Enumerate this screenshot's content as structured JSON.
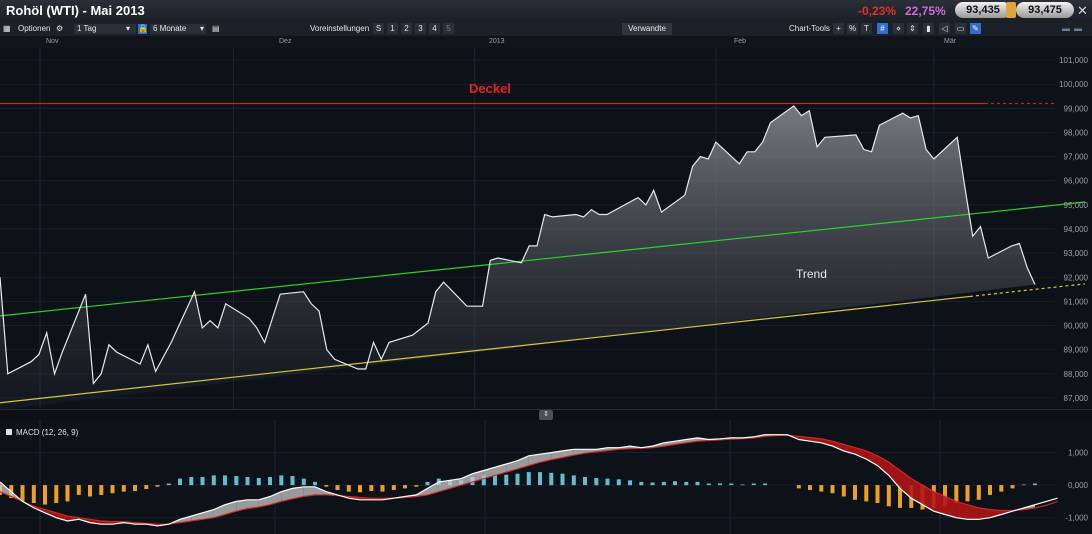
{
  "header": {
    "title": "Rohöl (WTI) - Mai 2013",
    "change_abs": "-0,23%",
    "change_pct": "22,75%",
    "bid": "93,435",
    "ask": "93,475"
  },
  "toolbar": {
    "optionen": "Optionen",
    "interval": "1 Tag",
    "range": "6 Monate",
    "voreinstellungen": "Voreinstellungen",
    "presets": [
      "S",
      "1",
      "2",
      "3",
      "4",
      "5"
    ],
    "verwandte": "Verwandte",
    "chart_tools": "Chart-Tools"
  },
  "colors": {
    "price_line": "#e8e8e8",
    "resistance": "#d02020",
    "upper_trend": "#2fd02f",
    "lower_trend": "#d8c83a",
    "macd_pos_bar": "#5fbfd0",
    "macd_neg_bar": "#f0a020",
    "signal": "#d02828"
  },
  "chart_data": [
    {
      "type": "area",
      "x": [
        "2012-11-01",
        "2012-11-02",
        "2012-11-05",
        "2012-11-06",
        "2012-11-07",
        "2012-11-08",
        "2012-11-09",
        "2012-11-12",
        "2012-11-13",
        "2012-11-14",
        "2012-11-15",
        "2012-11-16",
        "2012-11-19",
        "2012-11-20",
        "2012-11-21",
        "2012-11-23",
        "2012-11-26",
        "2012-11-27",
        "2012-11-28",
        "2012-11-29",
        "2012-11-30",
        "2012-12-03",
        "2012-12-04",
        "2012-12-05",
        "2012-12-06",
        "2012-12-07",
        "2012-12-10",
        "2012-12-11",
        "2012-12-12",
        "2012-12-13",
        "2012-12-14",
        "2012-12-17",
        "2012-12-18",
        "2012-12-19",
        "2012-12-20",
        "2012-12-21",
        "2012-12-24",
        "2012-12-26",
        "2012-12-27",
        "2012-12-28",
        "2012-12-31",
        "2013-01-02",
        "2013-01-03",
        "2013-01-04",
        "2013-01-07",
        "2013-01-08",
        "2013-01-09",
        "2013-01-10",
        "2013-01-11",
        "2013-01-14",
        "2013-01-15",
        "2013-01-16",
        "2013-01-17",
        "2013-01-18",
        "2013-01-22",
        "2013-01-23",
        "2013-01-24",
        "2013-01-25",
        "2013-01-28",
        "2013-01-29",
        "2013-01-30",
        "2013-01-31",
        "2013-02-01",
        "2013-02-04",
        "2013-02-05",
        "2013-02-06",
        "2013-02-07",
        "2013-02-08",
        "2013-02-11",
        "2013-02-12",
        "2013-02-13",
        "2013-02-14",
        "2013-02-15",
        "2013-02-19",
        "2013-02-20",
        "2013-02-21",
        "2013-02-22",
        "2013-02-25",
        "2013-02-26",
        "2013-02-27",
        "2013-02-28",
        "2013-03-01",
        "2013-03-04",
        "2013-03-05",
        "2013-03-06",
        "2013-03-07",
        "2013-03-08",
        "2013-03-11",
        "2013-03-12",
        "2013-03-13",
        "2013-03-14"
      ],
      "y": [
        92.0,
        88.0,
        88.5,
        88.8,
        89.7,
        88.0,
        88.9,
        91.3,
        87.6,
        88.0,
        89.2,
        88.9,
        88.4,
        89.2,
        88.1,
        89.3,
        91.4,
        89.9,
        90.2,
        89.9,
        90.9,
        90.3,
        89.9,
        89.3,
        90.3,
        91.3,
        91.4,
        90.9,
        90.6,
        89.0,
        88.6,
        88.2,
        88.2,
        89.3,
        88.6,
        89.3,
        89.6,
        90.1,
        91.4,
        91.8,
        90.8,
        90.8,
        92.7,
        92.8,
        92.6,
        93.3,
        93.3,
        94.6,
        94.5,
        94.6,
        94.5,
        94.8,
        94.6,
        94.6,
        95.3,
        95.0,
        95.6,
        94.7,
        95.4,
        96.6,
        97.0,
        96.9,
        97.6,
        96.7,
        97.2,
        97.2,
        97.6,
        98.4,
        99.1,
        98.7,
        98.9,
        97.4,
        97.8,
        97.9,
        97.3,
        97.2,
        98.3,
        98.8,
        98.6,
        98.7,
        97.3,
        96.9,
        97.8,
        95.7,
        93.7,
        94.1,
        92.8,
        93.3,
        93.4,
        92.4,
        91.7,
        91.0,
        91.4,
        91.1,
        92.2,
        92.5,
        92.7,
        93.2,
        93.1,
        93.8
      ],
      "ylim": [
        86.5,
        101.5
      ],
      "y_ticks": [
        "87,000",
        "88,000",
        "89,000",
        "90,000",
        "91,000",
        "92,000",
        "93,000",
        "94,000",
        "95,000",
        "96,000",
        "97,000",
        "98,000",
        "99,000",
        "100,000",
        "101,000"
      ],
      "x_ticks": [
        "Nov",
        "Dez",
        "2013",
        "Feb",
        "Mär"
      ],
      "annotations": [
        {
          "text": "Deckel",
          "type": "horizontal",
          "y": 99.2
        },
        {
          "text": "Trend",
          "type": "trendline",
          "from": [
            "2012-11-01",
            86.8
          ],
          "to": [
            "2013-03-14",
            91.5
          ]
        },
        {
          "type": "trendline",
          "from": [
            "2012-11-01",
            90.4
          ],
          "to": [
            "2013-03-14",
            94.9
          ]
        }
      ],
      "grid": true
    },
    {
      "type": "bar",
      "title": "MACD (12, 26, 9)",
      "values": [
        -0.3,
        -0.4,
        -0.5,
        -0.55,
        -0.6,
        -0.55,
        -0.5,
        -0.3,
        -0.35,
        -0.3,
        -0.25,
        -0.2,
        -0.18,
        -0.12,
        -0.05,
        0.05,
        0.2,
        0.25,
        0.25,
        0.3,
        0.3,
        0.28,
        0.25,
        0.22,
        0.25,
        0.3,
        0.28,
        0.2,
        0.1,
        -0.05,
        -0.15,
        -0.2,
        -0.22,
        -0.18,
        -0.2,
        -0.15,
        -0.1,
        -0.05,
        0.1,
        0.2,
        0.15,
        0.15,
        0.25,
        0.3,
        0.3,
        0.32,
        0.35,
        0.4,
        0.4,
        0.38,
        0.35,
        0.3,
        0.25,
        0.22,
        0.2,
        0.18,
        0.15,
        0.1,
        0.08,
        0.1,
        0.12,
        0.1,
        0.1,
        0.05,
        0.05,
        0.05,
        0.02,
        0.05,
        0.05,
        0.0,
        0.0,
        -0.1,
        -0.15,
        -0.2,
        -0.25,
        -0.35,
        -0.45,
        -0.5,
        -0.55,
        -0.65,
        -0.7,
        -0.7,
        -0.75,
        -0.7,
        -0.65,
        -0.55,
        -0.5,
        -0.45,
        -0.3,
        -0.2,
        -0.1,
        0.02,
        0.05
      ],
      "macd_line": [
        0.1,
        -0.2,
        -0.5,
        -0.7,
        -0.85,
        -1.0,
        -1.1,
        -1.05,
        -1.15,
        -1.2,
        -1.2,
        -1.15,
        -1.2,
        -1.2,
        -1.25,
        -1.2,
        -1.05,
        -0.95,
        -0.85,
        -0.75,
        -0.6,
        -0.5,
        -0.45,
        -0.45,
        -0.35,
        -0.2,
        -0.1,
        -0.05,
        -0.05,
        -0.2,
        -0.3,
        -0.4,
        -0.45,
        -0.45,
        -0.45,
        -0.4,
        -0.35,
        -0.3,
        -0.1,
        0.1,
        0.15,
        0.2,
        0.35,
        0.45,
        0.55,
        0.65,
        0.75,
        0.9,
        0.95,
        1.0,
        1.05,
        1.1,
        1.1,
        1.1,
        1.15,
        1.15,
        1.2,
        1.15,
        1.2,
        1.3,
        1.35,
        1.4,
        1.45,
        1.4,
        1.42,
        1.45,
        1.45,
        1.48,
        1.55,
        1.55,
        1.55,
        1.4,
        1.35,
        1.3,
        1.2,
        1.05,
        0.95,
        0.8,
        0.6,
        0.3,
        -0.1,
        -0.4,
        -0.6,
        -0.8,
        -0.9,
        -1.0,
        -1.05,
        -1.05,
        -1.0,
        -0.9,
        -0.8,
        -0.7,
        -0.6,
        -0.5,
        -0.4
      ],
      "signal_line": [
        -0.2,
        -0.35,
        -0.5,
        -0.65,
        -0.75,
        -0.85,
        -0.95,
        -1.0,
        -1.05,
        -1.1,
        -1.12,
        -1.12,
        -1.15,
        -1.17,
        -1.2,
        -1.2,
        -1.15,
        -1.1,
        -1.05,
        -1.0,
        -0.9,
        -0.8,
        -0.72,
        -0.67,
        -0.6,
        -0.5,
        -0.42,
        -0.35,
        -0.3,
        -0.3,
        -0.32,
        -0.35,
        -0.38,
        -0.4,
        -0.4,
        -0.4,
        -0.38,
        -0.35,
        -0.3,
        -0.2,
        -0.1,
        0.0,
        0.1,
        0.2,
        0.3,
        0.4,
        0.5,
        0.6,
        0.7,
        0.78,
        0.85,
        0.92,
        0.98,
        1.02,
        1.06,
        1.1,
        1.12,
        1.13,
        1.15,
        1.2,
        1.25,
        1.3,
        1.35,
        1.37,
        1.39,
        1.41,
        1.43,
        1.45,
        1.5,
        1.52,
        1.53,
        1.5,
        1.46,
        1.42,
        1.35,
        1.25,
        1.15,
        1.05,
        0.9,
        0.7,
        0.45,
        0.2,
        0.0,
        -0.2,
        -0.35,
        -0.5,
        -0.6,
        -0.7,
        -0.75,
        -0.78,
        -0.78,
        -0.75,
        -0.7,
        -0.62,
        -0.5
      ],
      "ylim": [
        -1.5,
        2.0
      ],
      "y_ticks": [
        "-1,000",
        "0,000",
        "1,000"
      ],
      "grid": true
    }
  ]
}
